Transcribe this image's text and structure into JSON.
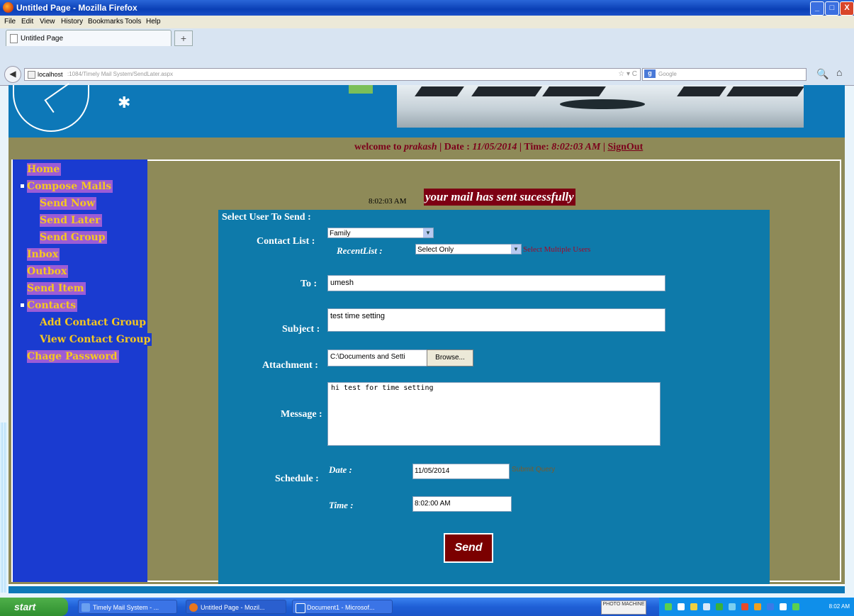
{
  "window": {
    "title": "Untitled Page - Mozilla Firefox",
    "buttons": {
      "minimize": "_",
      "maximize": "□",
      "close": "X"
    }
  },
  "menubar": [
    "File",
    "Edit",
    "View",
    "History",
    "Bookmarks",
    "Tools",
    "Help"
  ],
  "tab": {
    "label": "Untitled Page",
    "new_tab": "+"
  },
  "nav": {
    "url_host": "localhost",
    "url_path": ":1084/Timely Mail System/SendLater.aspx",
    "url_icons": "☆ ▾ C",
    "search_engine": "g",
    "search_placeholder": "Google"
  },
  "header": {
    "welcome_prefix": "welcome to",
    "user": "prakash",
    "date_label": "| Date :",
    "date": "11/05/2014",
    "time_label": "| Time:",
    "time": "8:02:03 AM",
    "sep": "|",
    "signout": "SignOut"
  },
  "sidebar": {
    "items": [
      "Home",
      "Compose Mails",
      "Send Now",
      "Send Later",
      "Send Group",
      "Inbox",
      "Outbox",
      "Send Item",
      "Contacts",
      "Add Contact Group",
      "View Contact Group",
      "Chage Password"
    ]
  },
  "status": {
    "time": "8:02:03 AM",
    "message": "your mail has sent sucessfully"
  },
  "form": {
    "heading": "Select User To Send :",
    "contact_list_label": "Contact List :",
    "contact_list_value": "Family",
    "recent_list_label": "RecentList :",
    "recent_list_value": "Select Only",
    "recent_hint": "Select Multiple Users",
    "to_label": "To :",
    "to_value": "umesh",
    "subject_label": "Subject :",
    "subject_value": "test time setting",
    "attachment_label": "Attachment :",
    "attachment_value": "C:\\Documents and Setti",
    "browse": "Browse...",
    "message_label": "Message :",
    "message_value": "hi test for time setting",
    "schedule_label": "Schedule :",
    "date_label": "Date :",
    "date_value": "11/05/2014",
    "submit_query": "Submit Query",
    "time_label": "Time :",
    "time_value": "8:02:00 AM",
    "send": "Send"
  },
  "taskbar": {
    "start": "start",
    "tasks": [
      "Timely Mail System - ...",
      "Untitled Page - Mozil...",
      "Document1 - Microsof..."
    ],
    "flag": "PHOTO\nMACHINE",
    "clock": "8:02 AM"
  },
  "colors": {
    "sidebar_bg": "#1a3bd0",
    "nav_text": "#f6c81f",
    "nav_highlight": "#9c5cd6",
    "content_bg": "#0e7aaa",
    "page_bg": "#8e8a58",
    "accent_red": "#7d0013"
  }
}
